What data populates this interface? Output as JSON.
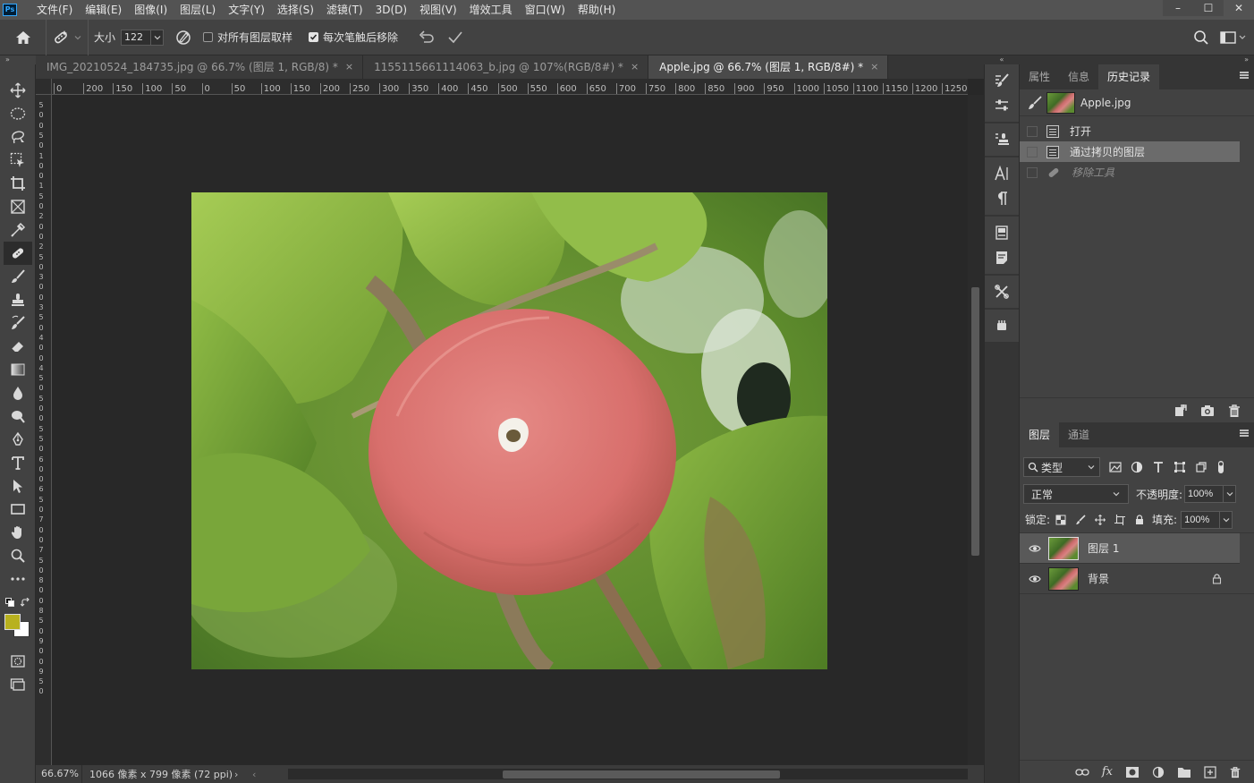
{
  "app": {
    "logo": "Ps"
  },
  "menu": [
    "文件(F)",
    "编辑(E)",
    "图像(I)",
    "图层(L)",
    "文字(Y)",
    "选择(S)",
    "滤镜(T)",
    "3D(D)",
    "视图(V)",
    "增效工具",
    "窗口(W)",
    "帮助(H)"
  ],
  "window_controls": {
    "minimize": "–",
    "maximize": "☐",
    "close": "✕"
  },
  "options": {
    "size_label": "大小",
    "size_value": "122",
    "sample_all_label": "对所有图层取样",
    "sample_all_checked": false,
    "remove_after_label": "每次笔触后移除",
    "remove_after_checked": true
  },
  "tabs": [
    {
      "label": "IMG_20210524_184735.jpg @ 66.7% (图层 1, RGB/8) *",
      "active": false
    },
    {
      "label": "1155115661114063_b.jpg @ 107%(RGB/8#) *",
      "active": false
    },
    {
      "label": "Apple.jpg @ 66.7% (图层 1, RGB/8#) *",
      "active": true
    }
  ],
  "tab_close": "×",
  "ruler_h": [
    "0",
    "200",
    "150",
    "100",
    "50",
    "0",
    "50",
    "100",
    "150",
    "200",
    "250",
    "300",
    "350",
    "400",
    "450",
    "500",
    "550",
    "600",
    "650",
    "700",
    "750",
    "800",
    "850",
    "900",
    "950",
    "1000",
    "1050",
    "1100",
    "1150",
    "1200",
    "1250"
  ],
  "ruler_v": [
    "5",
    "0",
    "0",
    "5",
    "0",
    "1",
    "0",
    "0",
    "1",
    "5",
    "0",
    "2",
    "0",
    "0",
    "2",
    "5",
    "0",
    "3",
    "0",
    "0",
    "3",
    "5",
    "0",
    "4",
    "0",
    "0",
    "4",
    "5",
    "0",
    "5",
    "0",
    "0",
    "5",
    "5",
    "0",
    "6",
    "0",
    "0",
    "6",
    "5",
    "0",
    "7",
    "0",
    "0",
    "7",
    "5",
    "0",
    "8",
    "0",
    "0",
    "8",
    "5",
    "0",
    "9",
    "0",
    "0",
    "9",
    "5",
    "0"
  ],
  "status": {
    "zoom": "66.67%",
    "info": "1066 像素 x 799 像素 (72 ppi)",
    "arrow_right": "›",
    "arrow_left": "‹"
  },
  "history_panel": {
    "tabs": [
      "属性",
      "信息",
      "历史记录"
    ],
    "active_tab": 2,
    "snapshot": "Apple.jpg",
    "items": [
      {
        "label": "打开",
        "state": "normal"
      },
      {
        "label": "通过拷贝的图层",
        "state": "selected"
      },
      {
        "label": "移除工具",
        "state": "dim"
      }
    ]
  },
  "layers_panel": {
    "tabs": [
      "图层",
      "通道"
    ],
    "active_tab": 0,
    "filter_label": "类型",
    "blend_mode": "正常",
    "opacity_label": "不透明度:",
    "opacity_value": "100%",
    "lock_label": "锁定:",
    "fill_label": "填充:",
    "fill_value": "100%",
    "layers": [
      {
        "name": "图层 1",
        "selected": true,
        "locked": false
      },
      {
        "name": "背景",
        "selected": false,
        "locked": true
      }
    ],
    "footer_fx": "fx"
  },
  "colors": {
    "foreground": "#b8b11e",
    "background": "#ffffff",
    "accent": "#31a8ff"
  }
}
